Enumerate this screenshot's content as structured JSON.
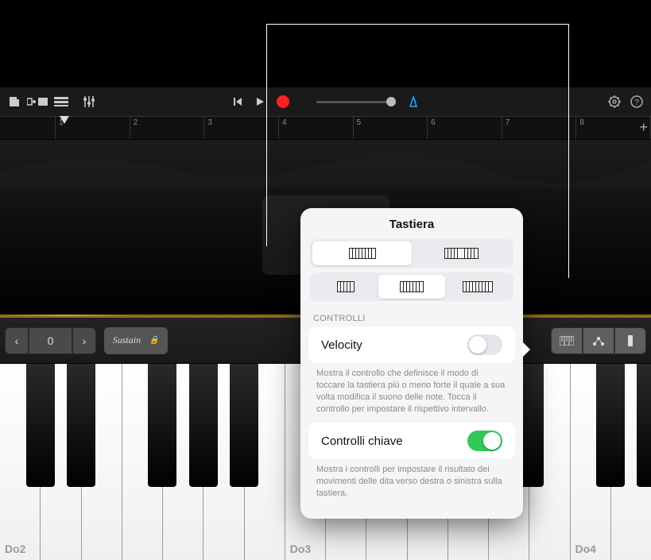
{
  "toolbar": {
    "ruler_marks": [
      "1",
      "2",
      "3",
      "4",
      "5",
      "6",
      "7",
      "8"
    ]
  },
  "kb_strip": {
    "octave_value": "0",
    "sustain_label": "Sustain"
  },
  "piano": {
    "labels": [
      "Do2",
      "Do3",
      "Do4"
    ]
  },
  "popup": {
    "title": "Tastiera",
    "section_label": "CONTROLLI",
    "velocity": {
      "label": "Velocity",
      "on": false,
      "desc": "Mostra il controllo che definisce il modo di toccare la tastiera più o meno forte il quale a sua volta modifica il suono delle note. Tocca il controllo per impostare il rispettivo intervallo."
    },
    "key_controls": {
      "label": "Controlli chiave",
      "on": true,
      "desc": "Mostra i controlli per impostare il risultato dei movimenti delle dita verso destra o sinistra sulla tastiera."
    }
  }
}
